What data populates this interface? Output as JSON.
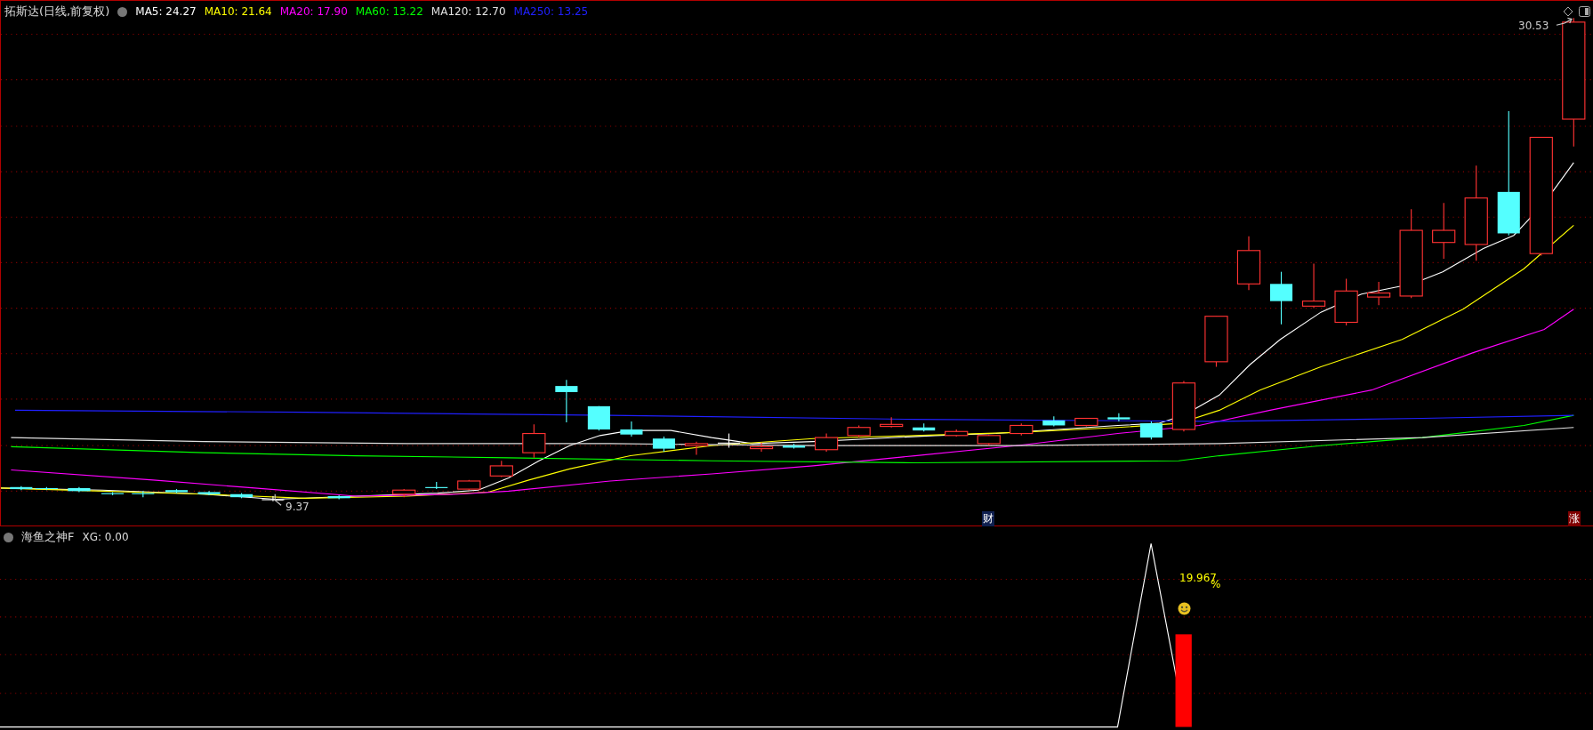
{
  "main_panel": {
    "title": "拓斯达(日线,前复权)",
    "indicators": [
      {
        "label": "MA5: 24.27",
        "color": "#ffffff"
      },
      {
        "label": "MA10: 21.64",
        "color": "#ffff00"
      },
      {
        "label": "MA20: 17.90",
        "color": "#ff00ff"
      },
      {
        "label": "MA60: 13.22",
        "color": "#00ff00"
      },
      {
        "label": "MA120: 12.70",
        "color": "#e0e0e0"
      },
      {
        "label": "MA250: 13.25",
        "color": "#2020ff"
      }
    ],
    "high_label": "30.53",
    "low_label": "9.37",
    "markers": [
      {
        "text": "财",
        "kind": "finance"
      },
      {
        "text": "涨",
        "kind": "rise"
      }
    ]
  },
  "sub_panel": {
    "title": "海鱼之神F",
    "reading": "XG: 0.00",
    "value_label": "19.967",
    "unit": "%"
  }
}
